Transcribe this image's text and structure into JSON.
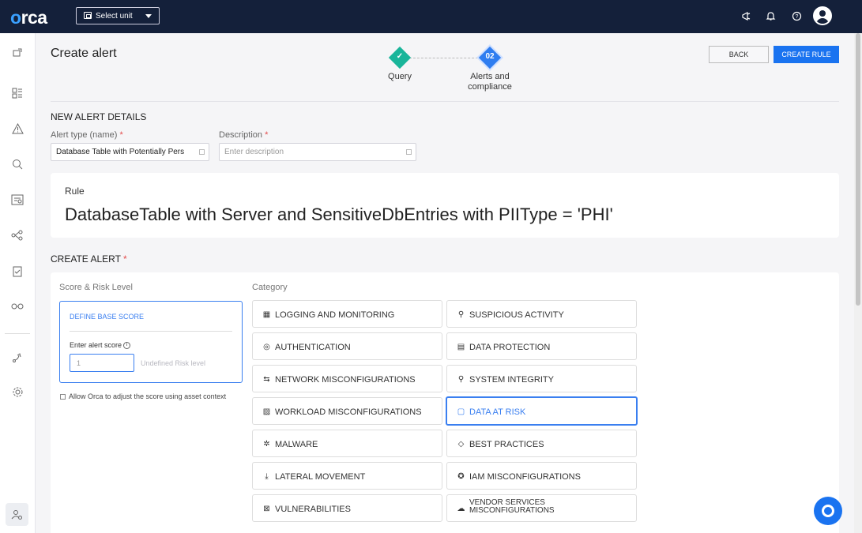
{
  "topbar": {
    "logo": "orca",
    "unit_select": "Select unit",
    "icons": [
      "megaphone-icon",
      "bell-icon",
      "help-icon"
    ]
  },
  "leftnav": {
    "icons": [
      "inventory-icon",
      "dashboard-icon",
      "alerts-icon",
      "search-icon",
      "compliance-icon",
      "graph-icon",
      "checklist-icon",
      "binoculars-icon",
      "integrations-icon",
      "settings-icon",
      "user-settings-icon"
    ]
  },
  "page": {
    "title": "Create alert"
  },
  "stepper": {
    "steps": [
      {
        "label": "Query",
        "marker": "✓",
        "state": "done"
      },
      {
        "label": "Alerts and compliance",
        "marker": "02",
        "state": "current"
      }
    ]
  },
  "actions": {
    "back": "BACK",
    "create": "CREATE RULE"
  },
  "new_alert": {
    "heading": "NEW ALERT DETAILS",
    "alert_type_label": "Alert type (name)",
    "alert_type_value": "Database Table with Potentially Pers",
    "description_label": "Description",
    "description_placeholder": "Enter description",
    "required_mark": "*"
  },
  "rule": {
    "title": "Rule",
    "text": "DatabaseTable with Server and SensitiveDbEntries with PIIType = 'PHI'"
  },
  "create_alert": {
    "heading": "CREATE ALERT",
    "required_mark": "*",
    "score_label": "Score & Risk Level",
    "define_score": "DEFINE BASE SCORE",
    "enter_score": "Enter alert score",
    "score_value": "1",
    "risk_level": "Undefined Risk level",
    "adjust_checkbox": "Allow Orca to adjust the score using asset context",
    "adjust_checked": false,
    "category_label": "Category",
    "categories": [
      {
        "label": "LOGGING AND MONITORING",
        "icon": "logging-icon",
        "selected": false
      },
      {
        "label": "SUSPICIOUS ACTIVITY",
        "icon": "suspicious-icon",
        "selected": false
      },
      {
        "label": "AUTHENTICATION",
        "icon": "fingerprint-icon",
        "selected": false
      },
      {
        "label": "DATA PROTECTION",
        "icon": "data-protection-icon",
        "selected": false
      },
      {
        "label": "NETWORK MISCONFIGURATIONS",
        "icon": "network-icon",
        "selected": false
      },
      {
        "label": "SYSTEM INTEGRITY",
        "icon": "system-integrity-icon",
        "selected": false
      },
      {
        "label": "WORKLOAD MISCONFIGURATIONS",
        "icon": "workload-icon",
        "selected": false
      },
      {
        "label": "DATA AT RISK",
        "icon": "file-icon",
        "selected": true
      },
      {
        "label": "MALWARE",
        "icon": "bug-icon",
        "selected": false
      },
      {
        "label": "BEST PRACTICES",
        "icon": "best-practices-icon",
        "selected": false
      },
      {
        "label": "LATERAL MOVEMENT",
        "icon": "lateral-movement-icon",
        "selected": false
      },
      {
        "label": "IAM MISCONFIGURATIONS",
        "icon": "iam-icon",
        "selected": false
      },
      {
        "label": "VULNERABILITIES",
        "icon": "vulnerability-icon",
        "selected": false
      },
      {
        "label": "VENDOR SERVICES\nMISCONFIGURATIONS",
        "icon": "cloud-icon",
        "selected": false
      }
    ]
  },
  "colors": {
    "accent": "#1a73f0",
    "topbar": "#14203a",
    "done": "#19b59a",
    "required": "#e34b4b"
  }
}
